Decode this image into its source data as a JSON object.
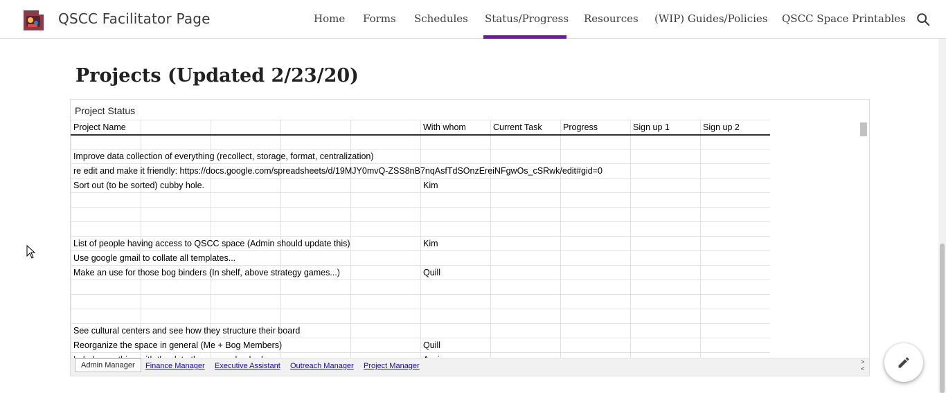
{
  "header": {
    "site_title": "QSCC Facilitator Page",
    "nav": [
      {
        "label": "Home"
      },
      {
        "label": "Forms"
      },
      {
        "label": "Schedules"
      },
      {
        "label": "Status/Progress",
        "active": true
      },
      {
        "label": "Resources"
      },
      {
        "label": "(WIP) Guides/Policies"
      },
      {
        "label": "QSCC Space Printables"
      }
    ],
    "search_icon": "search-icon",
    "accent_color": "#6a1b9a"
  },
  "page": {
    "heading": "Projects (Updated 2/23/20)"
  },
  "sheet": {
    "title": "Project Status",
    "columns": [
      "Project Name",
      "",
      "",
      "",
      "",
      "With whom",
      "Current Task",
      "Progress",
      "Sign up 1",
      "Sign up 2"
    ],
    "rows": [
      [
        "Improve data collection of everything (recollect, storage, format, centralization)",
        ""
      ],
      [
        "re edit and make it friendly: https://docs.google.com/spreadsheets/d/19MJY0mvQ-ZSS8nB7nqAsfTdSOnzEreiNFgwOs_cSRwk/edit#gid=0",
        ""
      ],
      [
        "Sort out (to be sorted) cubby hole.",
        "Kim"
      ],
      [
        "",
        ""
      ],
      [
        "",
        ""
      ],
      [
        "",
        ""
      ],
      [
        "List of people having access to QSCC space (Admin should update this)",
        "Kim"
      ],
      [
        "Use google gmail to collate all templates...",
        ""
      ],
      [
        "Make an use for those bog binders (In shelf, above strategy games...)",
        "Quill"
      ],
      [
        "",
        ""
      ],
      [
        "",
        ""
      ],
      [
        "",
        ""
      ],
      [
        "See cultural centers and see how they structure their board",
        ""
      ],
      [
        "Reorganize the space in general (Me + Bog Members)",
        "Quill"
      ],
      [
        "Label everything with the date they were checked",
        "Assign"
      ]
    ],
    "tabs": [
      {
        "label": "Admin Manager",
        "active": true
      },
      {
        "label": "Finance Manager"
      },
      {
        "label": "Executive Assistant"
      },
      {
        "label": "Outreach Manager"
      },
      {
        "label": "Project Manager"
      }
    ]
  },
  "fab": {
    "icon": "pencil-edit-icon"
  }
}
